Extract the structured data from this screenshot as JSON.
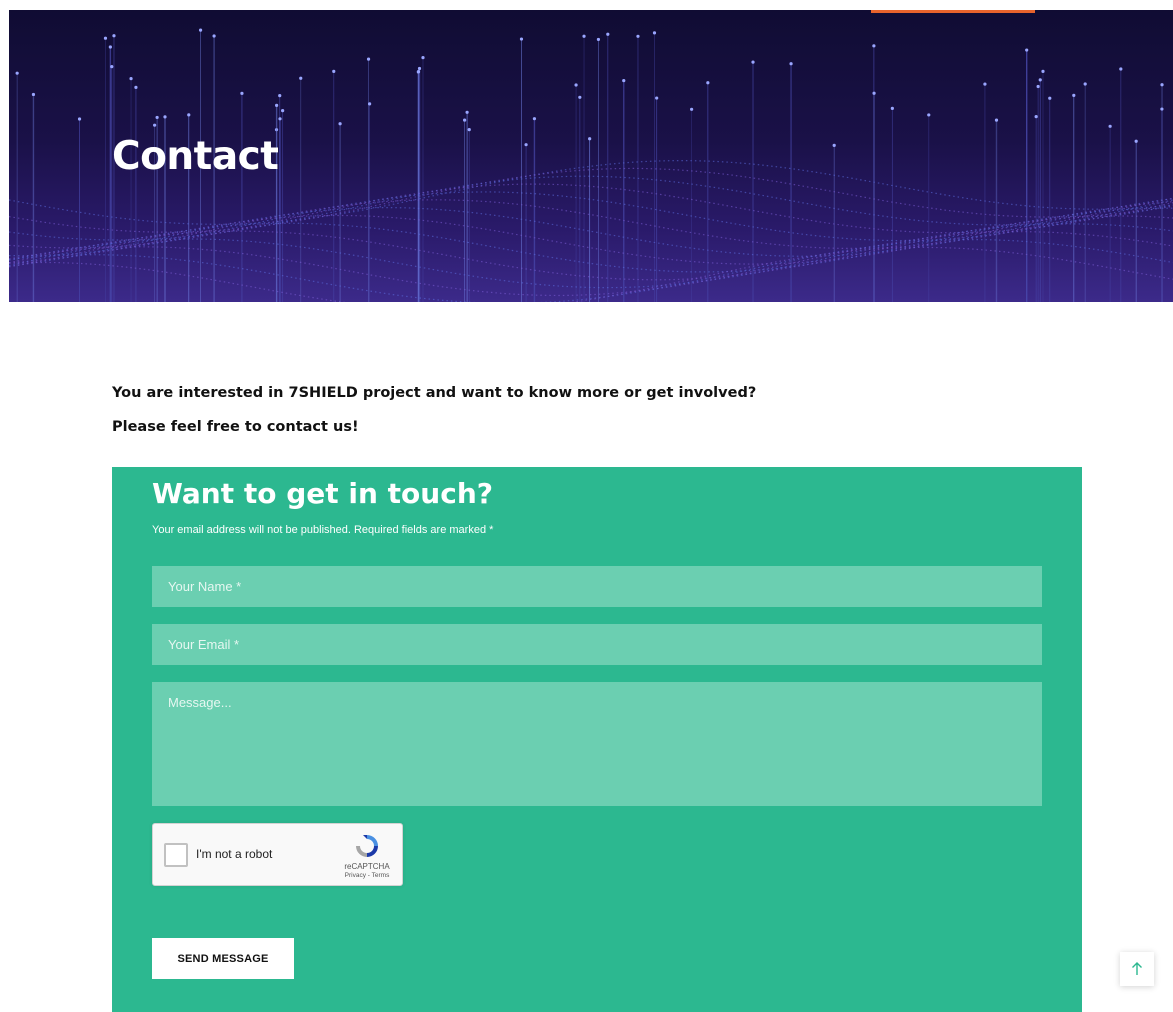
{
  "hero": {
    "title": "Contact"
  },
  "intro": {
    "line1": "You are interested in 7SHIELD project and want to know more or get involved?",
    "line2": "Please feel free to contact us!"
  },
  "form": {
    "heading": "Want to get in touch?",
    "note": "Your email address will not be published. Required fields are marked *",
    "name_placeholder": "Your Name *",
    "email_placeholder": "Your Email *",
    "message_placeholder": "Message...",
    "captcha": {
      "label": "I'm not a robot",
      "brand": "reCAPTCHA",
      "links": "Privacy - Terms"
    },
    "submit_label": "SEND MESSAGE"
  },
  "icons": {
    "scroll_top": "arrow-up-icon",
    "captcha_logo": "recaptcha-icon"
  },
  "colors": {
    "form_background": "#2cb890",
    "field_background": "#6bcfb1",
    "hero_accent": "#e8632c",
    "scroll_arrow": "#2cb890"
  }
}
